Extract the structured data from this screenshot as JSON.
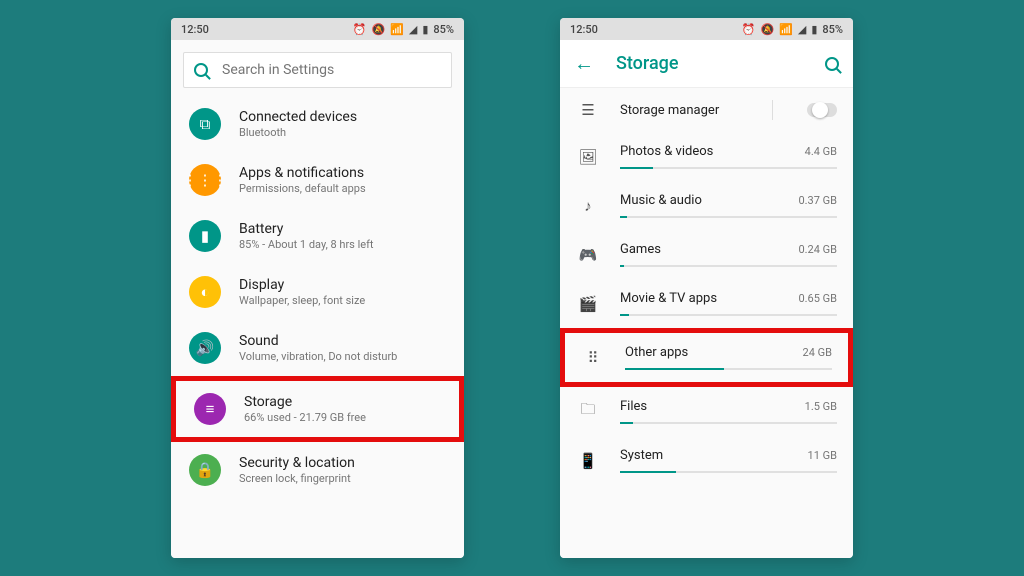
{
  "statusbar": {
    "time": "12:50",
    "battery": "85%"
  },
  "left": {
    "search_placeholder": "Search in Settings",
    "items": [
      {
        "title": "Connected devices",
        "sub": "Bluetooth"
      },
      {
        "title": "Apps & notifications",
        "sub": "Permissions, default apps"
      },
      {
        "title": "Battery",
        "sub": "85% - About 1 day, 8 hrs left"
      },
      {
        "title": "Display",
        "sub": "Wallpaper, sleep, font size"
      },
      {
        "title": "Sound",
        "sub": "Volume, vibration, Do not disturb"
      },
      {
        "title": "Storage",
        "sub": "66% used - 21.79 GB free"
      },
      {
        "title": "Security & location",
        "sub": "Screen lock, fingerprint"
      }
    ]
  },
  "right": {
    "appbar_title": "Storage",
    "manager_label": "Storage manager",
    "rows": [
      {
        "label": "Photos & videos",
        "size": "4.4 GB",
        "fill": 15
      },
      {
        "label": "Music & audio",
        "size": "0.37 GB",
        "fill": 3
      },
      {
        "label": "Games",
        "size": "0.24 GB",
        "fill": 2
      },
      {
        "label": "Movie & TV apps",
        "size": "0.65 GB",
        "fill": 4
      },
      {
        "label": "Other apps",
        "size": "24 GB",
        "fill": 48
      },
      {
        "label": "Files",
        "size": "1.5 GB",
        "fill": 6
      },
      {
        "label": "System",
        "size": "11 GB",
        "fill": 26
      }
    ]
  }
}
